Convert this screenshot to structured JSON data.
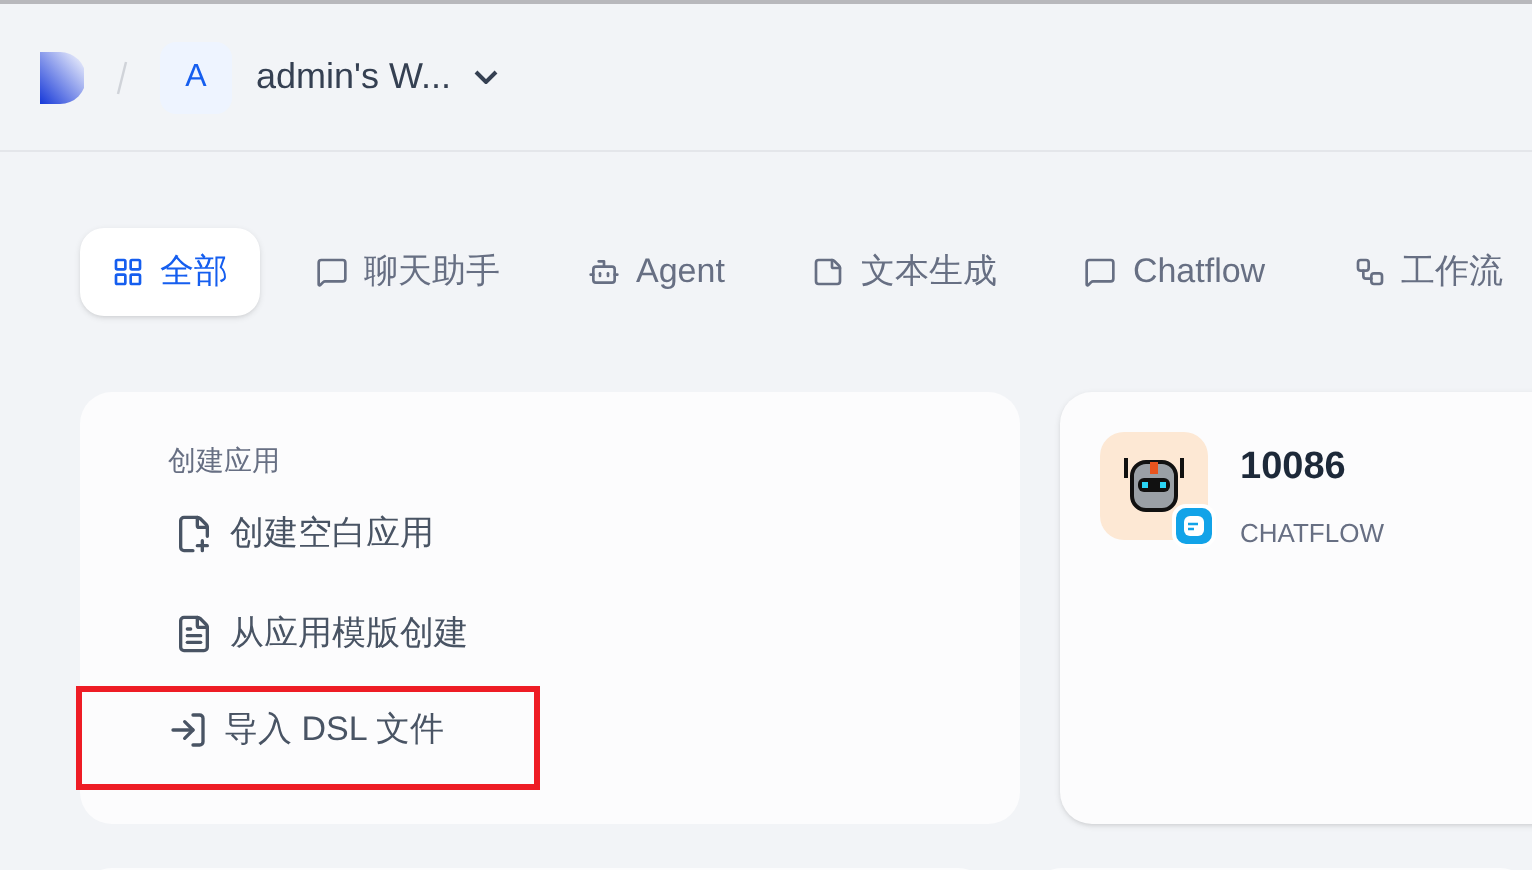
{
  "header": {
    "workspace_initial": "A",
    "workspace_name": "admin's W..."
  },
  "tabs": [
    {
      "label": "全部",
      "kind": "all",
      "selected": true
    },
    {
      "label": "聊天助手",
      "kind": "chat",
      "selected": false
    },
    {
      "label": "Agent",
      "kind": "agent",
      "selected": false
    },
    {
      "label": "文本生成",
      "kind": "text",
      "selected": false
    },
    {
      "label": "Chatflow",
      "kind": "chat",
      "selected": false
    },
    {
      "label": "工作流",
      "kind": "workflow",
      "selected": false
    }
  ],
  "create_card": {
    "title": "创建应用",
    "items": [
      {
        "label": "创建空白应用",
        "kind": "blank",
        "highlighted": false
      },
      {
        "label": "从应用模版创建",
        "kind": "template",
        "highlighted": false
      },
      {
        "label": "导入 DSL 文件",
        "kind": "import",
        "highlighted": true
      }
    ]
  },
  "apps": [
    {
      "name": "10086",
      "type": "CHATFLOW"
    }
  ]
}
